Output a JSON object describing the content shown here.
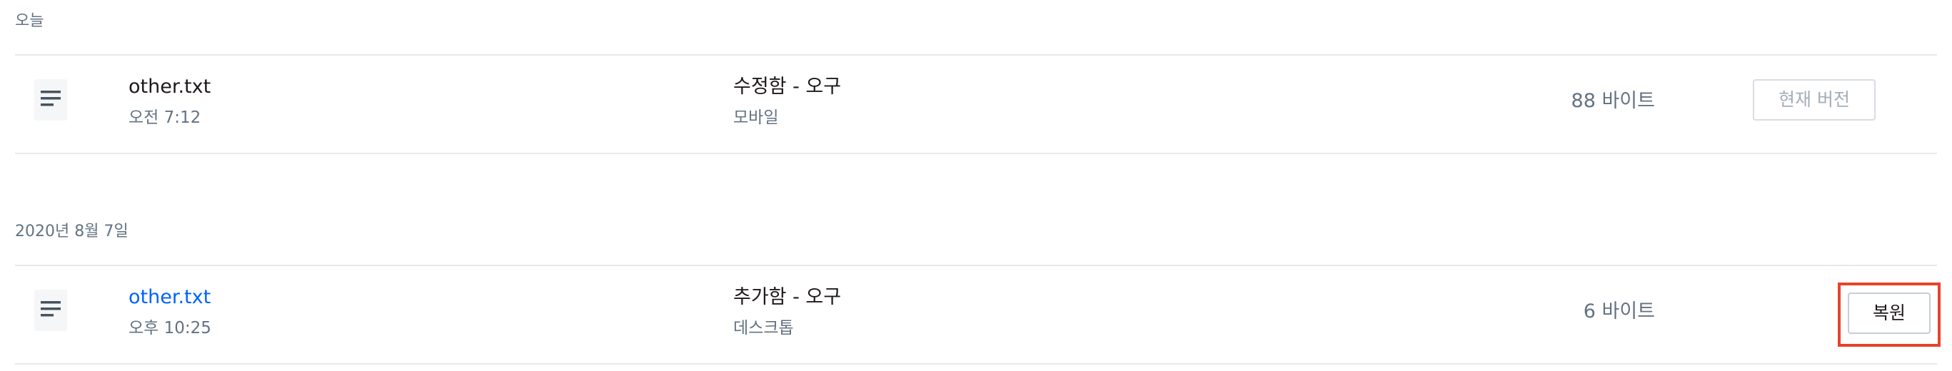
{
  "groups": [
    {
      "title": "오늘",
      "revision": {
        "icon": "text-file-icon",
        "file_name": "other.txt",
        "time": "오전 7:12",
        "action": "수정함 - 오구",
        "device": "모바일",
        "size": "88 바이트",
        "button_label": "현재 버전"
      }
    },
    {
      "title": "2020년 8월 7일",
      "revision": {
        "icon": "text-file-icon",
        "file_name": "other.txt",
        "time": "오후 10:25",
        "action": "추가함 - 오구",
        "device": "데스크톱",
        "size": "6 바이트",
        "button_label": "복원"
      }
    }
  ],
  "colors": {
    "link": "#0061fe",
    "highlight": "#e8432a",
    "muted_text": "#637282",
    "divider": "#e6e8eb"
  }
}
